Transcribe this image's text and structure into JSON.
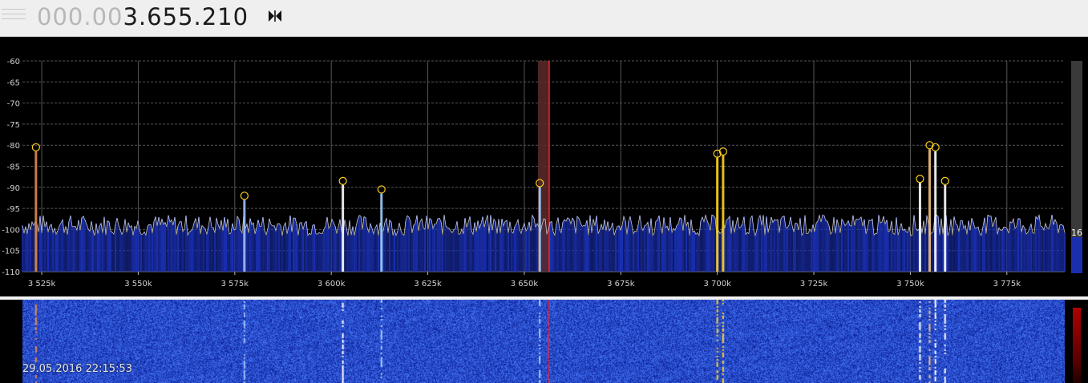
{
  "toolbar": {
    "frequency_prefix": "000.00",
    "frequency_main": "3.655.210",
    "swap_icon": "swap-icon"
  },
  "spectrum": {
    "y_axis_labels": [
      "-60",
      "-65",
      "-70",
      "-75",
      "-80",
      "-85",
      "-90",
      "-95",
      "-100",
      "-105",
      "-110"
    ],
    "y_range": [
      -110,
      -60
    ],
    "x_axis_labels": [
      "3 525k",
      "3 550k",
      "3 575k",
      "3 600k",
      "3 625k",
      "3 650k",
      "3 675k",
      "3 700k",
      "3 725k",
      "3 750k",
      "3 775k"
    ],
    "x_range_khz": [
      3520,
      3790
    ],
    "noise_floor_db": -99,
    "tuned_khz": 3655.2,
    "peaks": [
      {
        "khz": 3523.5,
        "db": -80.5,
        "color": "#e08a50"
      },
      {
        "khz": 3577.5,
        "db": -92.0,
        "color": "#9fc0ff"
      },
      {
        "khz": 3603.0,
        "db": -88.5,
        "color": "#ffffff"
      },
      {
        "khz": 3613.0,
        "db": -90.5,
        "color": "#9fd0ff"
      },
      {
        "khz": 3654.0,
        "db": -89.0,
        "color": "#9fd0ff"
      },
      {
        "khz": 3700.0,
        "db": -82.0,
        "color": "#ffd21a"
      },
      {
        "khz": 3701.5,
        "db": -81.5,
        "color": "#ffd21a"
      },
      {
        "khz": 3752.5,
        "db": -88.0,
        "color": "#ffffff"
      },
      {
        "khz": 3755.0,
        "db": -80.0,
        "color": "#f0c080"
      },
      {
        "khz": 3756.5,
        "db": -80.5,
        "color": "#ffffff"
      },
      {
        "khz": 3759.0,
        "db": -88.5,
        "color": "#ffffff"
      }
    ],
    "level_value": "16",
    "colors": {
      "fill": "#1a2fb0",
      "trace": "#d8d8d8",
      "grid": "#555555",
      "marker": "#ffd21a",
      "tuning": "#ff2020"
    }
  },
  "waterfall": {
    "timestamp": "29.05.2016 22:15:53"
  }
}
